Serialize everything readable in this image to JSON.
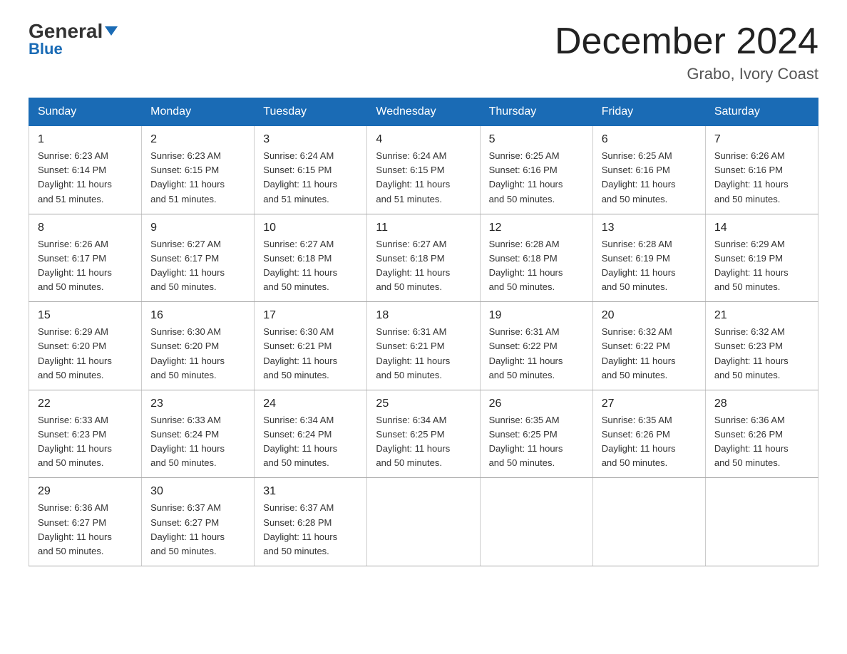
{
  "header": {
    "logo_main": "General",
    "logo_arrow": "▶",
    "logo_sub": "Blue",
    "month_title": "December 2024",
    "location": "Grabo, Ivory Coast"
  },
  "days_of_week": [
    "Sunday",
    "Monday",
    "Tuesday",
    "Wednesday",
    "Thursday",
    "Friday",
    "Saturday"
  ],
  "weeks": [
    [
      {
        "day": "1",
        "sunrise": "6:23 AM",
        "sunset": "6:14 PM",
        "daylight": "11 hours and 51 minutes."
      },
      {
        "day": "2",
        "sunrise": "6:23 AM",
        "sunset": "6:15 PM",
        "daylight": "11 hours and 51 minutes."
      },
      {
        "day": "3",
        "sunrise": "6:24 AM",
        "sunset": "6:15 PM",
        "daylight": "11 hours and 51 minutes."
      },
      {
        "day": "4",
        "sunrise": "6:24 AM",
        "sunset": "6:15 PM",
        "daylight": "11 hours and 51 minutes."
      },
      {
        "day": "5",
        "sunrise": "6:25 AM",
        "sunset": "6:16 PM",
        "daylight": "11 hours and 50 minutes."
      },
      {
        "day": "6",
        "sunrise": "6:25 AM",
        "sunset": "6:16 PM",
        "daylight": "11 hours and 50 minutes."
      },
      {
        "day": "7",
        "sunrise": "6:26 AM",
        "sunset": "6:16 PM",
        "daylight": "11 hours and 50 minutes."
      }
    ],
    [
      {
        "day": "8",
        "sunrise": "6:26 AM",
        "sunset": "6:17 PM",
        "daylight": "11 hours and 50 minutes."
      },
      {
        "day": "9",
        "sunrise": "6:27 AM",
        "sunset": "6:17 PM",
        "daylight": "11 hours and 50 minutes."
      },
      {
        "day": "10",
        "sunrise": "6:27 AM",
        "sunset": "6:18 PM",
        "daylight": "11 hours and 50 minutes."
      },
      {
        "day": "11",
        "sunrise": "6:27 AM",
        "sunset": "6:18 PM",
        "daylight": "11 hours and 50 minutes."
      },
      {
        "day": "12",
        "sunrise": "6:28 AM",
        "sunset": "6:18 PM",
        "daylight": "11 hours and 50 minutes."
      },
      {
        "day": "13",
        "sunrise": "6:28 AM",
        "sunset": "6:19 PM",
        "daylight": "11 hours and 50 minutes."
      },
      {
        "day": "14",
        "sunrise": "6:29 AM",
        "sunset": "6:19 PM",
        "daylight": "11 hours and 50 minutes."
      }
    ],
    [
      {
        "day": "15",
        "sunrise": "6:29 AM",
        "sunset": "6:20 PM",
        "daylight": "11 hours and 50 minutes."
      },
      {
        "day": "16",
        "sunrise": "6:30 AM",
        "sunset": "6:20 PM",
        "daylight": "11 hours and 50 minutes."
      },
      {
        "day": "17",
        "sunrise": "6:30 AM",
        "sunset": "6:21 PM",
        "daylight": "11 hours and 50 minutes."
      },
      {
        "day": "18",
        "sunrise": "6:31 AM",
        "sunset": "6:21 PM",
        "daylight": "11 hours and 50 minutes."
      },
      {
        "day": "19",
        "sunrise": "6:31 AM",
        "sunset": "6:22 PM",
        "daylight": "11 hours and 50 minutes."
      },
      {
        "day": "20",
        "sunrise": "6:32 AM",
        "sunset": "6:22 PM",
        "daylight": "11 hours and 50 minutes."
      },
      {
        "day": "21",
        "sunrise": "6:32 AM",
        "sunset": "6:23 PM",
        "daylight": "11 hours and 50 minutes."
      }
    ],
    [
      {
        "day": "22",
        "sunrise": "6:33 AM",
        "sunset": "6:23 PM",
        "daylight": "11 hours and 50 minutes."
      },
      {
        "day": "23",
        "sunrise": "6:33 AM",
        "sunset": "6:24 PM",
        "daylight": "11 hours and 50 minutes."
      },
      {
        "day": "24",
        "sunrise": "6:34 AM",
        "sunset": "6:24 PM",
        "daylight": "11 hours and 50 minutes."
      },
      {
        "day": "25",
        "sunrise": "6:34 AM",
        "sunset": "6:25 PM",
        "daylight": "11 hours and 50 minutes."
      },
      {
        "day": "26",
        "sunrise": "6:35 AM",
        "sunset": "6:25 PM",
        "daylight": "11 hours and 50 minutes."
      },
      {
        "day": "27",
        "sunrise": "6:35 AM",
        "sunset": "6:26 PM",
        "daylight": "11 hours and 50 minutes."
      },
      {
        "day": "28",
        "sunrise": "6:36 AM",
        "sunset": "6:26 PM",
        "daylight": "11 hours and 50 minutes."
      }
    ],
    [
      {
        "day": "29",
        "sunrise": "6:36 AM",
        "sunset": "6:27 PM",
        "daylight": "11 hours and 50 minutes."
      },
      {
        "day": "30",
        "sunrise": "6:37 AM",
        "sunset": "6:27 PM",
        "daylight": "11 hours and 50 minutes."
      },
      {
        "day": "31",
        "sunrise": "6:37 AM",
        "sunset": "6:28 PM",
        "daylight": "11 hours and 50 minutes."
      },
      null,
      null,
      null,
      null
    ]
  ],
  "labels": {
    "sunrise": "Sunrise:",
    "sunset": "Sunset:",
    "daylight": "Daylight:"
  }
}
